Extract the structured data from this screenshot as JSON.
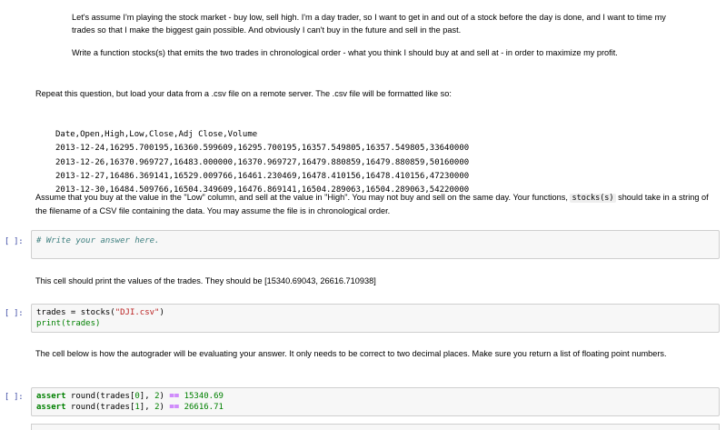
{
  "intro": {
    "para1": "Let's assume I'm playing the stock market - buy low, sell high. I'm a day trader, so I want to get in and out of a stock before the day is done, and I want to time my trades so that I make the biggest gain possible. And obviously I can't buy in the future and sell in the past.",
    "para2": "Write a function stocks(s) that emits the two trades in chronological order - what you think I should buy at and sell at - in order to maximize my profit."
  },
  "repeat_text": "Repeat this question, but load your data from a .csv file on a remote server. The .csv file will be formatted like so:",
  "csv_lines": [
    "Date,Open,High,Low,Close,Adj Close,Volume",
    "2013-12-24,16295.700195,16360.599609,16295.700195,16357.549805,16357.549805,33640000",
    "2013-12-26,16370.969727,16483.000000,16370.969727,16479.880859,16479.880859,50160000",
    "2013-12-27,16486.369141,16529.009766,16461.230469,16478.410156,16478.410156,47230000",
    "2013-12-30,16484.509766,16504.349609,16476.869141,16504.289063,16504.289063,54220000"
  ],
  "assume": {
    "before": "Assume that you buy at the value in the \"Low\" column, and sell at the value in \"High\". You may not buy and sell on the same day. Your functions, ",
    "code": "stocks(s)",
    "after": " should take in a string of the filename of a CSV file containing the data. You may assume the file is in chronological order."
  },
  "cell1": {
    "prompt": "[ ]:",
    "comment": "# Write your answer here."
  },
  "print_text": "This cell should print the values of the trades. They should be [15340.69043, 26616.710938]",
  "cell2": {
    "prompt": "[ ]:",
    "line1_var": "trades = stocks(",
    "line1_str": "\"DJI.csv\"",
    "line1_end": ")",
    "line2": "print(trades)"
  },
  "autograder_text": "The cell below is how the autograder will be evaluating your answer. It only needs to be correct to two decimal places. Make sure you return a list of floating point numbers.",
  "cell3": {
    "prompt": "[ ]:",
    "kw": "assert",
    "line1_mid": " round(trades[",
    "idx0": "0",
    "line_mid2": "], ",
    "two": "2",
    "close": ") ",
    "eq": "==",
    "val1": " 15340.69",
    "idx1": "1",
    "val2": " 26616.71"
  }
}
